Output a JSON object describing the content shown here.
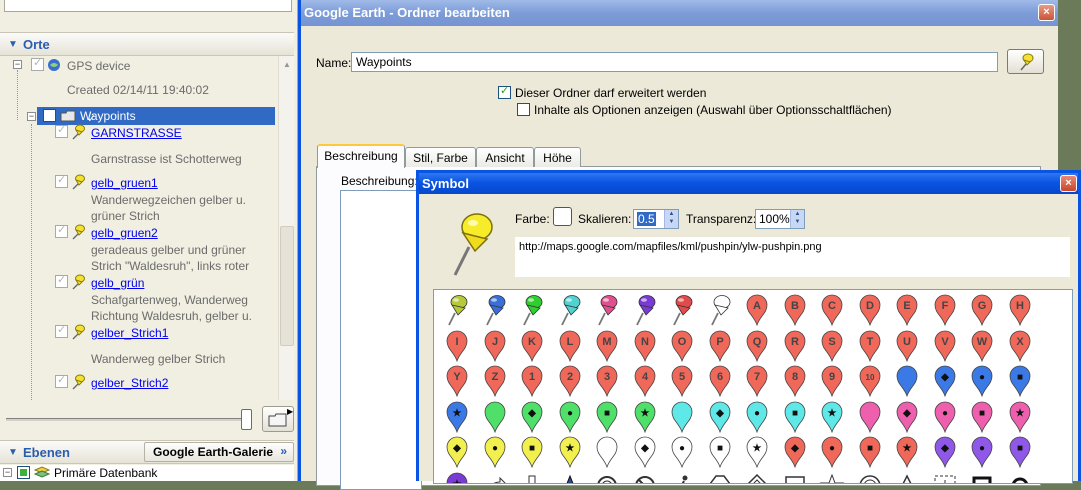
{
  "left_panel": {
    "places_title": "Orte",
    "layers_title": "Ebenen",
    "gallery_button": "Google Earth-Galerie",
    "gallery_arrow": "»",
    "gps_label": "GPS device",
    "gps_created": "Created 02/14/11 19:40:02",
    "folder_label": "Waypoints",
    "items": [
      {
        "name": "GARNSTRASSE",
        "desc": "Garnstrasse ist Schotterweg"
      },
      {
        "name": "gelb_gruen1",
        "desc": "Wanderwegzeichen gelber u.\ngrüner Strich"
      },
      {
        "name": "gelb_gruen2",
        "desc": "geradeaus gelber und grüner\nStrich \"Waldesruh\", links roter"
      },
      {
        "name": "gelb_grün",
        "desc": "Schafgartenweg, Wanderweg\nRichtung Waldesruh, gelber u."
      },
      {
        "name": "gelber_Strich1",
        "desc": "Wanderweg gelber Strich"
      },
      {
        "name": "gelber_Strich2",
        "desc": ""
      }
    ],
    "db_label": "Primäre Datenbank"
  },
  "dialog": {
    "title": "Google Earth - Ordner bearbeiten",
    "name_label": "Name:",
    "name_value": "Waypoints",
    "check_expand": "Dieser Ordner darf erweitert werden",
    "check_expand_checked": true,
    "check_radio": "Inhalte als Optionen anzeigen (Auswahl über Optionsschaltflächen)",
    "check_radio_checked": false,
    "tabs": [
      "Beschreibung",
      "Stil, Farbe",
      "Ansicht",
      "Höhe"
    ],
    "active_tab": "Beschreibung",
    "desc_label": "Beschreibung:",
    "close": "×"
  },
  "symbol_dialog": {
    "title": "Symbol",
    "color_label": "Farbe:",
    "scale_label": "Skalieren:",
    "scale_value": "0.5",
    "opacity_label": "Transparenz:",
    "opacity_value": "100%",
    "url": "http://maps.google.com/mapfiles/kml/pushpin/ylw-pushpin.png",
    "close": "×"
  },
  "icons": {
    "row1_pins": [
      "#b6c93a",
      "#3b6fd8",
      "#2fcf2f",
      "#52d1d1",
      "#e0508f",
      "#7a3ad6",
      "#e24b4b",
      "#ffffff"
    ],
    "row1_letters": [
      "A",
      "B",
      "C",
      "D",
      "E",
      "F",
      "G",
      "H"
    ],
    "row2_letters": [
      "I",
      "J",
      "K",
      "L",
      "M",
      "N",
      "O",
      "P",
      "Q",
      "R",
      "S",
      "T",
      "U",
      "V",
      "W",
      "X"
    ],
    "row3_labels": [
      "Y",
      "Z",
      "1",
      "2",
      "3",
      "4",
      "5",
      "6",
      "7",
      "8",
      "9",
      "10"
    ],
    "row3_extras": [
      {
        "color": "#3b7ae6",
        "glyph": ""
      },
      {
        "color": "#3b7ae6",
        "glyph": "◆"
      },
      {
        "color": "#3b7ae6",
        "glyph": "●"
      },
      {
        "color": "#3b7ae6",
        "glyph": "■"
      }
    ],
    "row4": [
      {
        "color": "#3b7ae6",
        "glyph": "★"
      },
      {
        "color": "#4fe06a",
        "glyph": ""
      },
      {
        "color": "#4fe06a",
        "glyph": "◆"
      },
      {
        "color": "#4fe06a",
        "glyph": "●"
      },
      {
        "color": "#4fe06a",
        "glyph": "■"
      },
      {
        "color": "#4fe06a",
        "glyph": "★"
      },
      {
        "color": "#5fe8e8",
        "glyph": ""
      },
      {
        "color": "#5fe8e8",
        "glyph": "◆"
      },
      {
        "color": "#5fe8e8",
        "glyph": "●"
      },
      {
        "color": "#5fe8e8",
        "glyph": "■"
      },
      {
        "color": "#5fe8e8",
        "glyph": "★"
      },
      {
        "color": "#ee5fae",
        "glyph": ""
      },
      {
        "color": "#ee5fae",
        "glyph": "◆"
      },
      {
        "color": "#ee5fae",
        "glyph": "●"
      },
      {
        "color": "#ee5fae",
        "glyph": "■"
      },
      {
        "color": "#ee5fae",
        "glyph": "★"
      }
    ],
    "row5": [
      {
        "color": "#f2f04f",
        "glyph": "◆"
      },
      {
        "color": "#f2f04f",
        "glyph": "●"
      },
      {
        "color": "#f2f04f",
        "glyph": "■"
      },
      {
        "color": "#f2f04f",
        "glyph": "★"
      },
      {
        "color": "#ffffff",
        "glyph": ""
      },
      {
        "color": "#ffffff",
        "glyph": "◆"
      },
      {
        "color": "#ffffff",
        "glyph": "●"
      },
      {
        "color": "#ffffff",
        "glyph": "■"
      },
      {
        "color": "#ffffff",
        "glyph": "★"
      },
      {
        "color": "#f0685a",
        "glyph": "◆"
      },
      {
        "color": "#f0685a",
        "glyph": "●"
      },
      {
        "color": "#f0685a",
        "glyph": "■"
      },
      {
        "color": "#f0685a",
        "glyph": "★"
      },
      {
        "color": "#9058e8",
        "glyph": "◆"
      },
      {
        "color": "#9058e8",
        "glyph": "●"
      },
      {
        "color": "#9058e8",
        "glyph": "■"
      }
    ],
    "row6": [
      "purple-star-pin-icon",
      "arrow-shape-icon",
      "trail-head-icon",
      "triangle-icon",
      "circle-icon",
      "no-entry-icon",
      "hiker-icon",
      "hexagon-icon",
      "diamond-outline-icon",
      "square-outline-icon",
      "star-outline-icon",
      "target-icon",
      "triangle-outline-icon",
      "crosshair-square-icon",
      "square-dot-icon",
      "circle-dot-icon"
    ]
  },
  "colors": {
    "xp_blue": "#0a54e3",
    "selection": "#316ac5",
    "pin_red": "#f0685a",
    "link": "#0000ee"
  }
}
